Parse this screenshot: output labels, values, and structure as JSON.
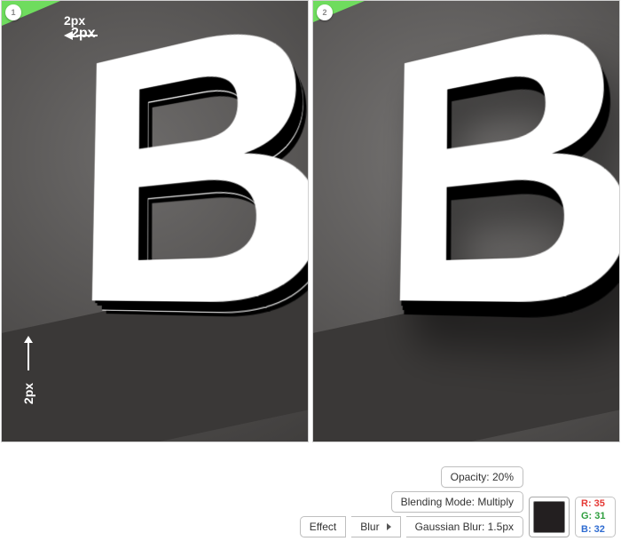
{
  "previews": {
    "left": {
      "step": "1",
      "offset_x_label": "2px",
      "offset_y_label": "2px"
    },
    "right": {
      "step": "2"
    },
    "glyph": "B"
  },
  "controls": {
    "opacity_label": "Opacity: 20%",
    "blend_label": "Blending Mode: Multiply",
    "effect_label": "Effect",
    "blur_menu_label": "Blur",
    "gaussian_label": "Gaussian Blur: 1.5px"
  },
  "swatch": {
    "hex": "#231f20",
    "r_label": "R: 35",
    "g_label": "G: 31",
    "b_label": "B: 32"
  }
}
